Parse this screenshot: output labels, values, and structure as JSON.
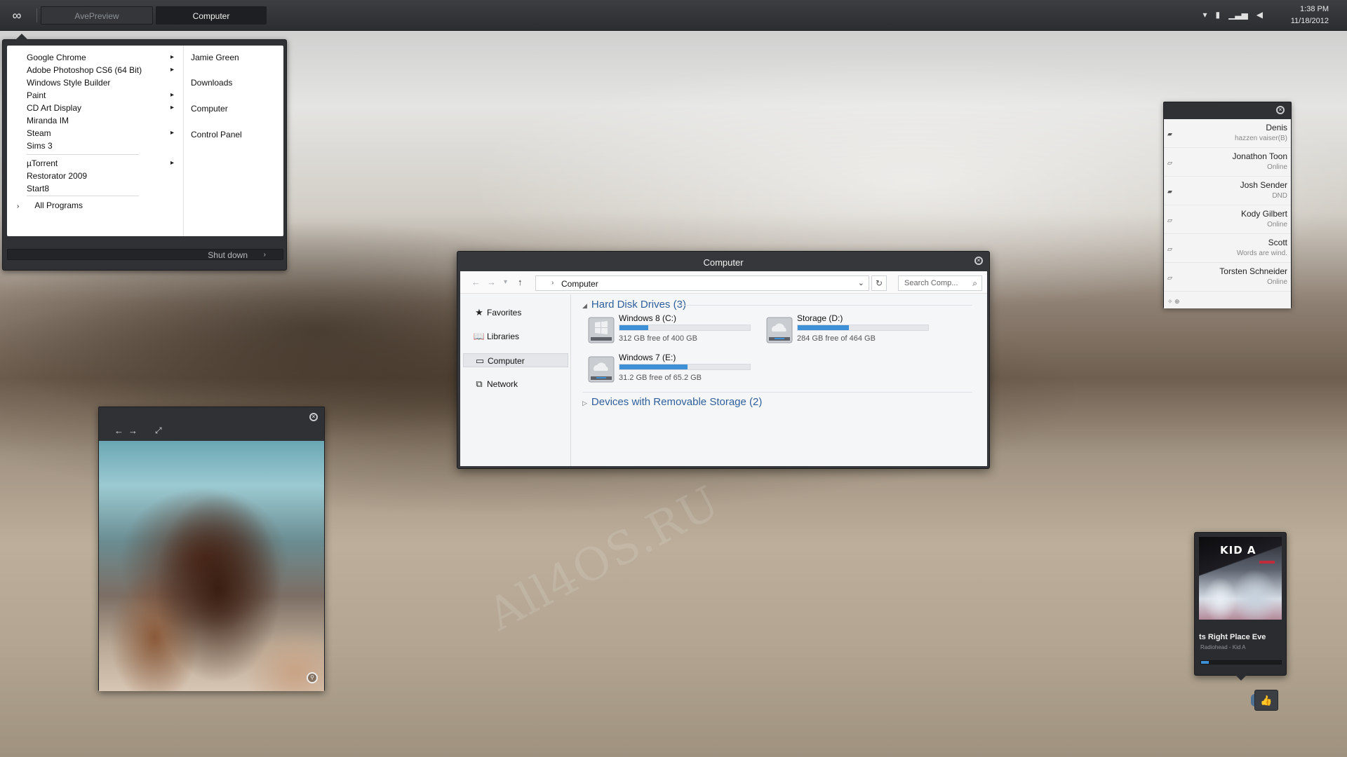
{
  "taskbar": {
    "start_icon": "infinity-icon",
    "tasks": [
      "AvePreview",
      "Computer"
    ],
    "tray_icons": [
      "chevron-down-icon",
      "battery-icon",
      "signal-icon",
      "speaker-icon"
    ],
    "time": "1:38 PM",
    "date": "11/18/2012"
  },
  "start_menu": {
    "programs": [
      {
        "label": "Google Chrome",
        "submenu": true
      },
      {
        "label": "Adobe Photoshop CS6 (64 Bit)",
        "submenu": true
      },
      {
        "label": "Windows Style Builder",
        "submenu": false
      },
      {
        "label": "Paint",
        "submenu": true
      },
      {
        "label": "CD Art Display",
        "submenu": true
      },
      {
        "label": "Miranda IM",
        "submenu": false
      },
      {
        "label": "Steam",
        "submenu": true
      },
      {
        "label": "Sims 3",
        "submenu": false
      },
      {
        "label": "µTorrent",
        "submenu": true
      },
      {
        "label": "Restorator 2009",
        "submenu": false
      },
      {
        "label": "Start8",
        "submenu": false
      }
    ],
    "all_programs": "All Programs",
    "places": [
      "Jamie Green",
      "Downloads",
      "Computer",
      "Control Panel"
    ],
    "shutdown": "Shut down"
  },
  "explorer": {
    "title": "Computer",
    "address": "Computer",
    "search_placeholder": "Search Comp...",
    "nav": [
      {
        "label": "Favorites",
        "icon": "star-icon"
      },
      {
        "label": "Libraries",
        "icon": "book-icon"
      },
      {
        "label": "Computer",
        "icon": "laptop-icon",
        "selected": true
      },
      {
        "label": "Network",
        "icon": "network-icon"
      }
    ],
    "groups": {
      "hdd": "Hard Disk Drives (3)",
      "removable": "Devices with Removable Storage (2)"
    },
    "drives": [
      {
        "name": "Windows 8 (C:)",
        "free": "312 GB free of 400 GB",
        "used_fraction": 0.22
      },
      {
        "name": "Storage (D:)",
        "free": "284 GB free of 464 GB",
        "used_fraction": 0.39
      },
      {
        "name": "Windows 7 (E:)",
        "free": "31.2 GB free of 65.2 GB",
        "used_fraction": 0.52
      }
    ]
  },
  "contacts": [
    {
      "name": "Denis",
      "status": "hazzen vaiser(B)"
    },
    {
      "name": "Jonathon Toon",
      "status": "Online"
    },
    {
      "name": "Josh Sender",
      "status": "DND"
    },
    {
      "name": "Kody Gilbert",
      "status": "Online"
    },
    {
      "name": "Scott",
      "status": "Words are wind."
    },
    {
      "name": "Torsten Schneider",
      "status": "Online"
    }
  ],
  "music": {
    "album_art_text": "KID A",
    "track": "ts Right Place    Eve",
    "artist_album": "Radiohead - Kid A",
    "progress_fraction": 0.1
  },
  "watermark": "All4OS.RU",
  "colors": {
    "accent": "#3d8fd6",
    "group_heading": "#2f5f9c",
    "chrome": "#2f3135"
  }
}
